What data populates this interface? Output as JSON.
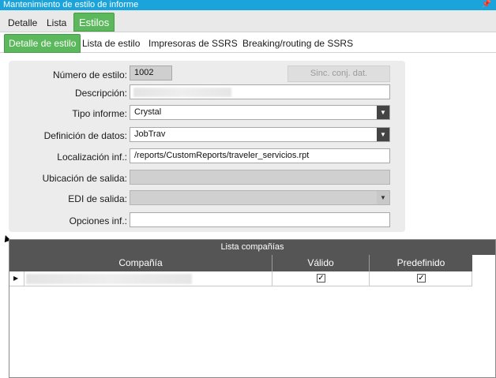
{
  "window": {
    "title": "Mantenimiento de estilo de informe",
    "pin_icon": "pin-icon"
  },
  "main_tabs": [
    {
      "label": "Detalle",
      "active": false
    },
    {
      "label": "Lista",
      "active": false
    },
    {
      "label": "Estilos",
      "active": true
    }
  ],
  "sub_tabs": [
    {
      "label": "Detalle de estilo",
      "active": true
    },
    {
      "label": "Lista de estilo",
      "active": false
    },
    {
      "label": "Impresoras de SSRS",
      "active": false
    },
    {
      "label": "Breaking/routing de SSRS",
      "active": false
    }
  ],
  "form": {
    "numero_label": "Número de estilo:",
    "numero_value": "1002",
    "sinc_button": "Sinc. conj. dat.",
    "descripcion_label": "Descripción:",
    "descripcion_value": "",
    "tipo_label": "Tipo informe:",
    "tipo_value": "Crystal",
    "definicion_label": "Definición de datos:",
    "definicion_value": "JobTrav",
    "localizacion_label": "Localización inf.:",
    "localizacion_value": "/reports/CustomReports/traveler_servicios.rpt",
    "ubicacion_label": "Ubicación de salida:",
    "ubicacion_value": "",
    "edi_label": "EDI de salida:",
    "edi_value": "",
    "opciones_label": "Opciones inf.:",
    "opciones_value": ""
  },
  "companias": {
    "title": "Lista compañías",
    "columns": [
      "Compañía",
      "Válido",
      "Predefinido"
    ],
    "rows": [
      {
        "compania": "",
        "valido": true,
        "predefinido": true
      }
    ]
  },
  "colors": {
    "accent": "#5cb85c",
    "titlebar": "#1ba3dc",
    "grid_header": "#555555"
  }
}
